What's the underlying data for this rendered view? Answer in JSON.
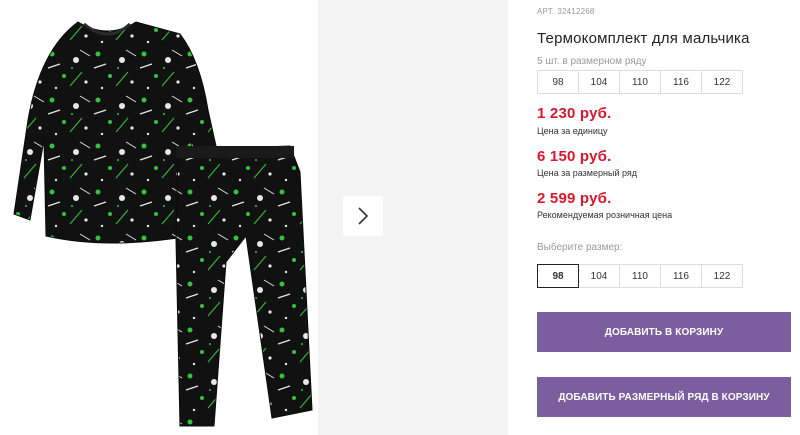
{
  "gallery": {
    "main_image": "boys-thermal-pajama-black-with-green-white-splatter",
    "next_icon": "chevron-right-icon"
  },
  "product": {
    "sku_label": "АРТ.",
    "sku_value": "32412268",
    "title": "Термокомплект для мальчика",
    "pack_note": "5 шт. в размерном ряду",
    "pack_sizes": [
      "98",
      "104",
      "110",
      "116",
      "122"
    ],
    "prices": {
      "unit_value": "1 230 руб.",
      "unit_label": "Цена за единицу",
      "series_value": "6 150 руб.",
      "series_label": "Цена за размерный ряд",
      "retail_value": "2 599 руб.",
      "retail_label": "Рекомендуемая розничная цена"
    },
    "choose_size_label": "Выберите размер:",
    "size_options": [
      "98",
      "104",
      "110",
      "116",
      "122"
    ],
    "selected_size": "98"
  },
  "actions": {
    "add_to_cart": "Добавить в корзину",
    "add_series_to_cart": "Добавить размерный ряд в корзину"
  },
  "colors": {
    "price": "#d9182d",
    "button": "#7a5e9d",
    "garment": "#111111",
    "splatter_green": "#35c23a",
    "splatter_white": "#e8e8e8"
  }
}
